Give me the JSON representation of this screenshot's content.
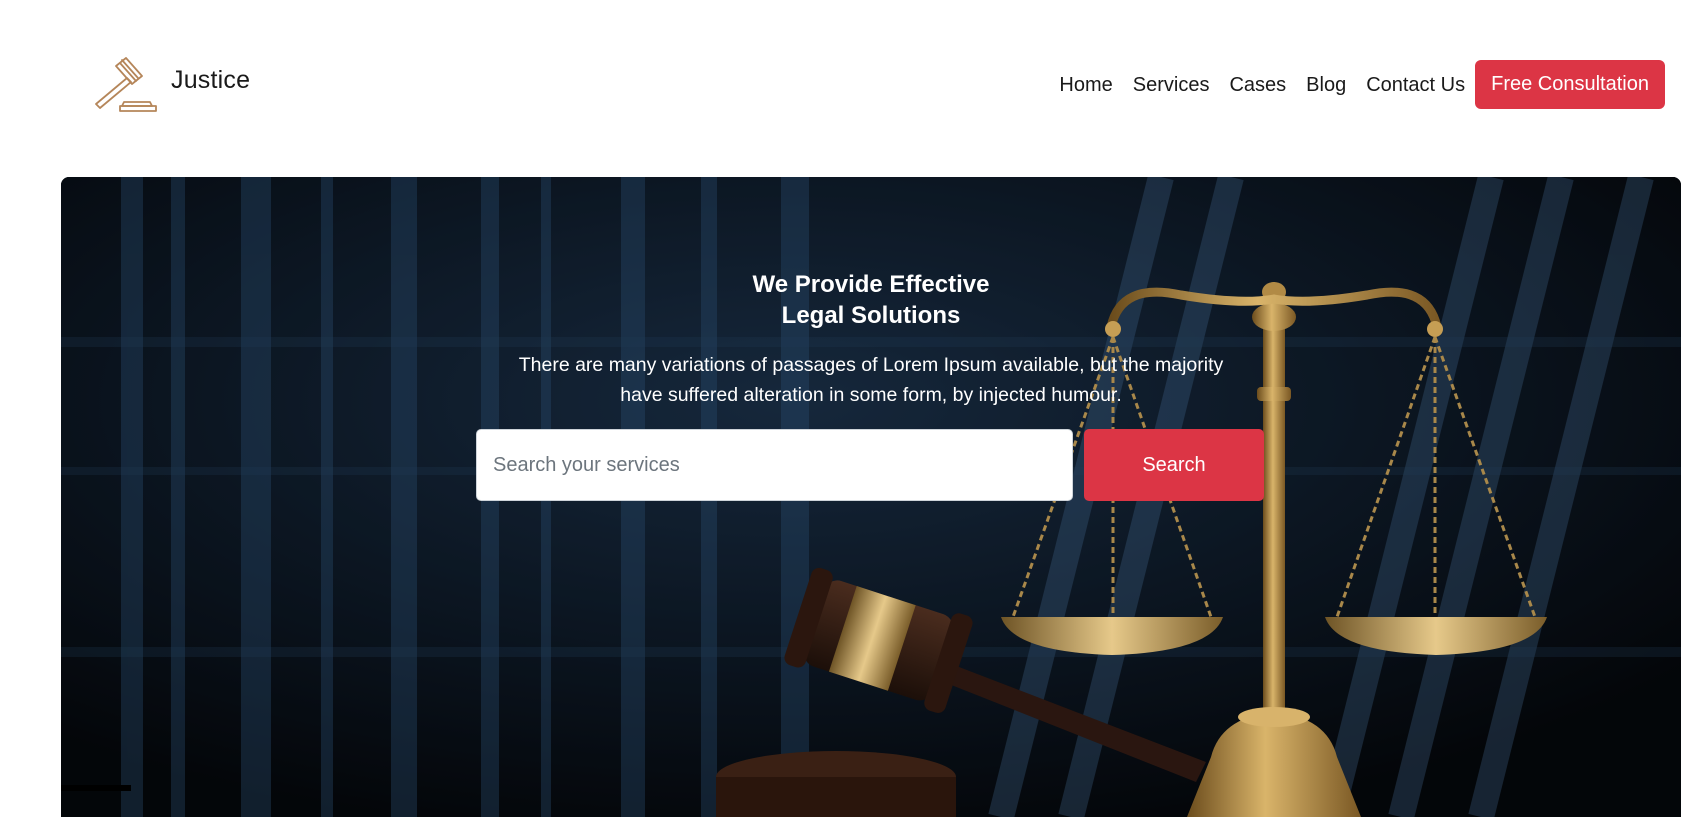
{
  "brand": {
    "name": "Justice",
    "icon": "gavel-icon",
    "icon_color": "#b5865a"
  },
  "nav": {
    "items": [
      {
        "label": "Home"
      },
      {
        "label": "Services"
      },
      {
        "label": "Cases"
      },
      {
        "label": "Blog"
      },
      {
        "label": "Contact Us"
      }
    ],
    "cta_label": "Free Consultation"
  },
  "hero": {
    "title_line1": "We Provide Effective",
    "title_line2": "Legal Solutions",
    "subtitle_line1": "There are many variations of passages of Lorem Ipsum available, but the majority",
    "subtitle_line2": "have suffered alteration in some form, by injected humour.",
    "search_placeholder": "Search your services",
    "search_button": "Search",
    "background_image": "scales-of-justice-and-gavel-photo"
  },
  "colors": {
    "accent": "#dc3545",
    "hero_dark": "#0b1119",
    "brass": "#b8934a"
  }
}
